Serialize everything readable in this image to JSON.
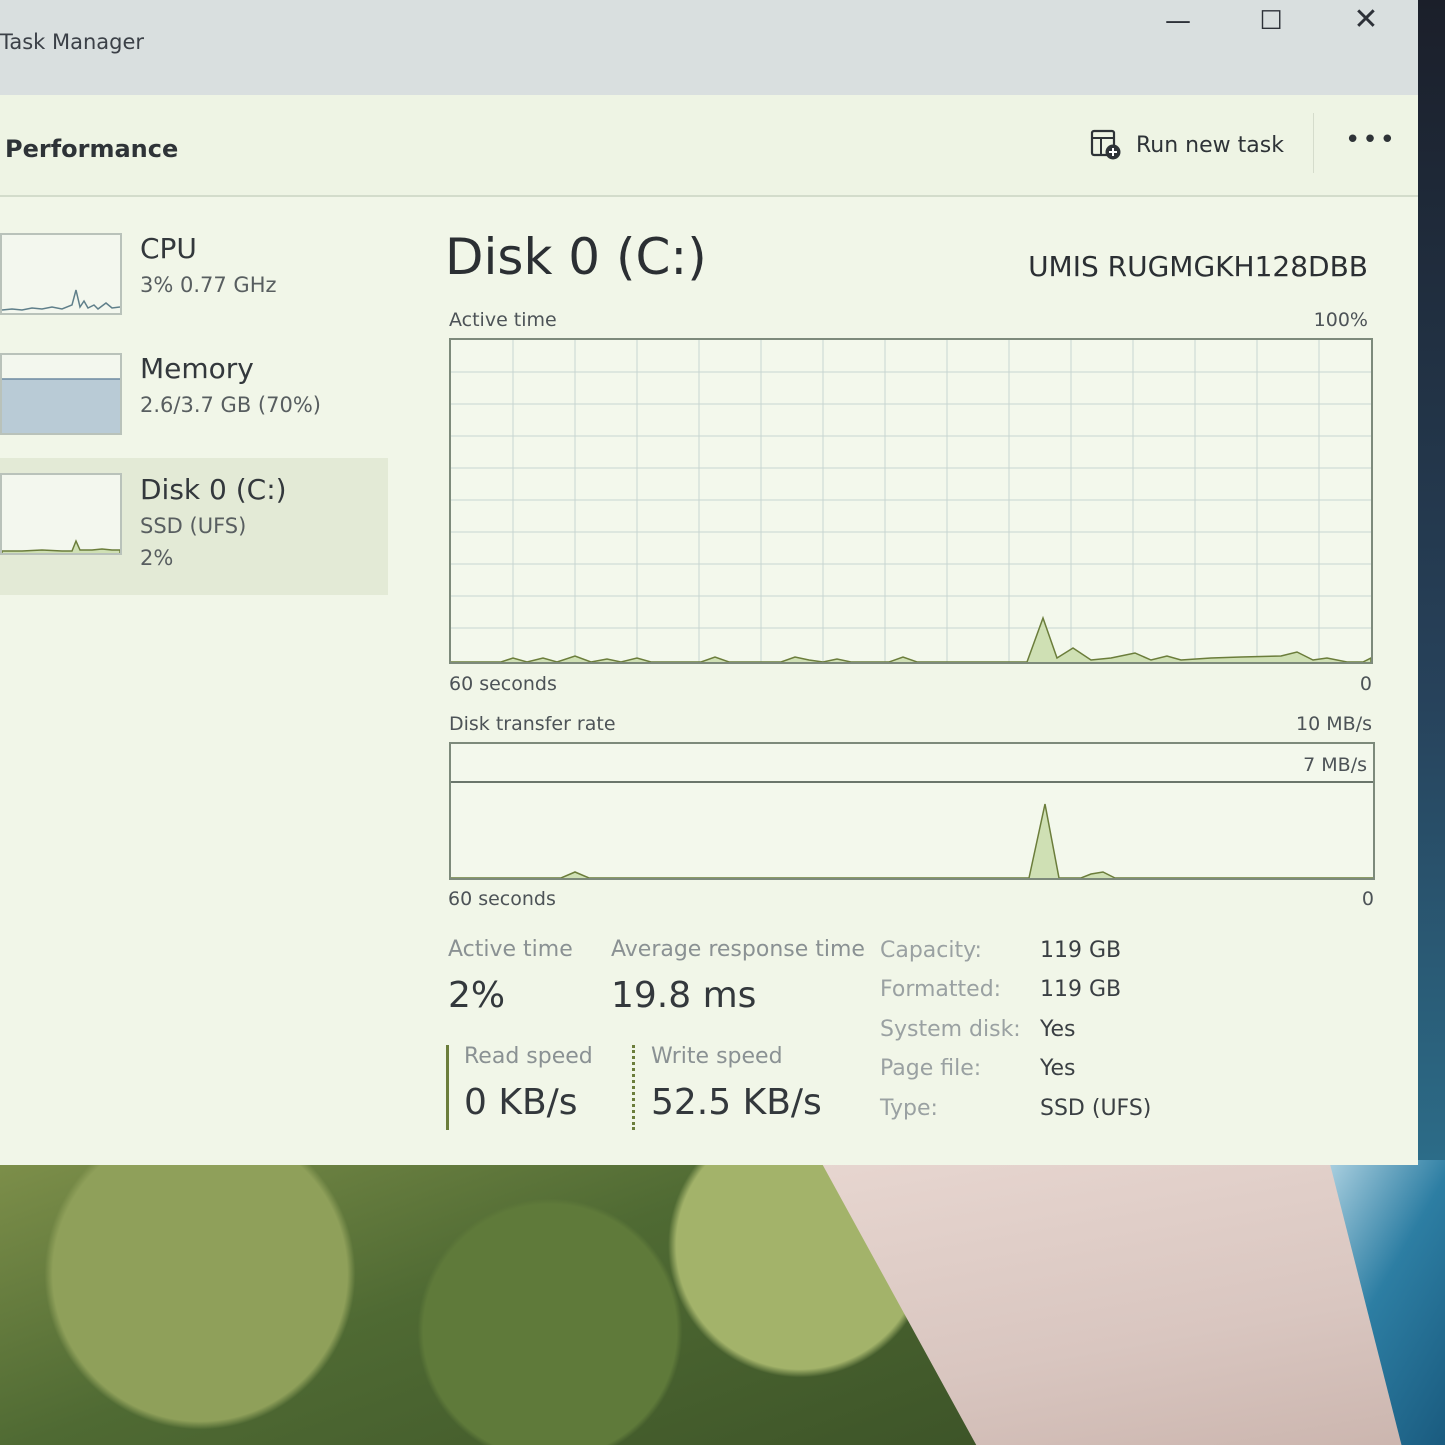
{
  "window": {
    "title": "Task Manager"
  },
  "window_controls": {
    "minimize": "—",
    "maximize": "☐",
    "close": "✕"
  },
  "header": {
    "page_title": "Performance",
    "run_new_task": "Run new task",
    "more": "•••"
  },
  "sidebar": {
    "items": [
      {
        "name": "CPU",
        "detail": "3% 0.77 GHz"
      },
      {
        "name": "Memory",
        "detail": "2.6/3.7 GB (70%)"
      },
      {
        "name": "Disk 0 (C:)",
        "detail": "SSD (UFS)",
        "detail2": "2%"
      }
    ]
  },
  "main": {
    "title": "Disk 0 (C:)",
    "model": "UMIS RUGMGKH128DBB",
    "active_graph": {
      "label": "Active time",
      "max": "100%",
      "time_span": "60 seconds",
      "min": "0"
    },
    "transfer_graph": {
      "label": "Disk transfer rate",
      "max": "10 MB/s",
      "line_label": "7 MB/s",
      "time_span": "60 seconds",
      "min": "0"
    },
    "stats": {
      "active_time_label": "Active time",
      "active_time_value": "2%",
      "response_label": "Average response time",
      "response_value": "19.8 ms",
      "read_label": "Read speed",
      "read_value": "0 KB/s",
      "write_label": "Write speed",
      "write_value": "52.5 KB/s"
    },
    "info": [
      {
        "key": "Capacity:",
        "value": "119 GB"
      },
      {
        "key": "Formatted:",
        "value": "119 GB"
      },
      {
        "key": "System disk:",
        "value": "Yes"
      },
      {
        "key": "Page file:",
        "value": "Yes"
      },
      {
        "key": "Type:",
        "value": "SSD (UFS)"
      }
    ]
  },
  "colors": {
    "accent": "#6b7d3b",
    "graph_fill": "#cfe0b4",
    "grid": "#c7d6d2"
  }
}
